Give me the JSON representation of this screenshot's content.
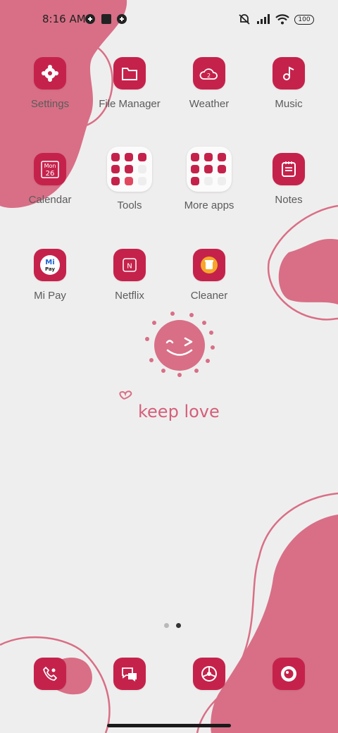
{
  "status": {
    "time": "8:16 AM",
    "battery": "100"
  },
  "apps_row1": [
    "Settings",
    "File Manager",
    "Weather",
    "Music"
  ],
  "apps_row2": [
    "Calendar",
    "Tools",
    "More apps",
    "Notes"
  ],
  "apps_row3": [
    "Mi Pay",
    "Netflix",
    "Cleaner"
  ],
  "calendar": {
    "day": "Mon",
    "date": "26"
  },
  "weather": {
    "temp": "2"
  },
  "mipay": {
    "top": "Mi",
    "bottom": "Pay"
  },
  "netflix": {
    "glyph": "N"
  },
  "wallpaper": {
    "tagline": "keep love"
  },
  "pager": {
    "pages": 2,
    "current": 2
  },
  "dock": [
    "phone-icon",
    "messages-icon",
    "browser-icon",
    "camera-icon"
  ],
  "colors": {
    "accent": "#c5224b",
    "blob": "#d86f86",
    "background": "#efeeee"
  }
}
